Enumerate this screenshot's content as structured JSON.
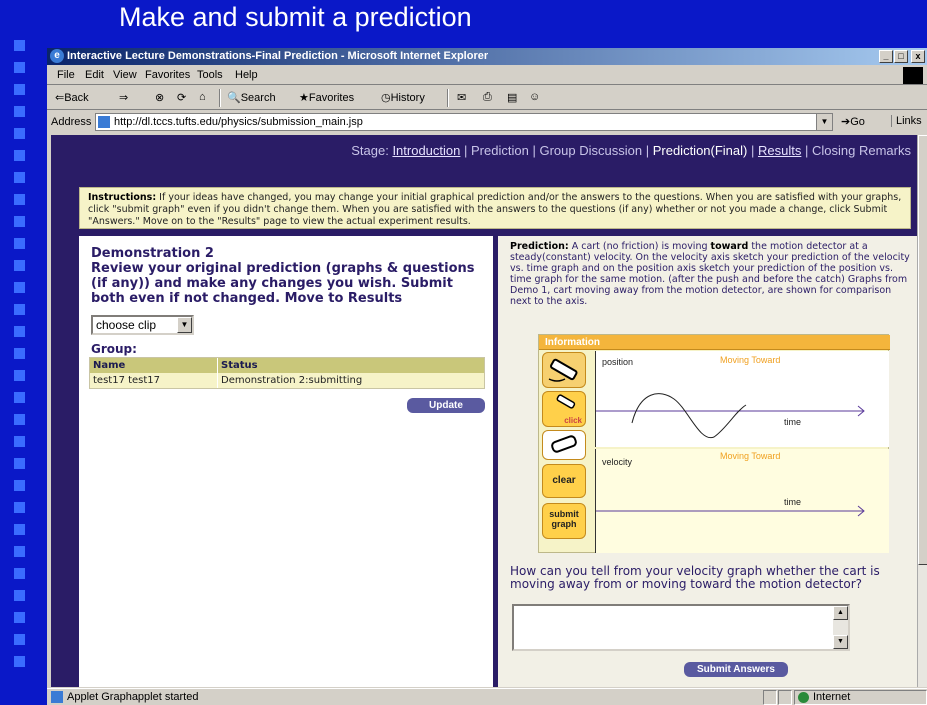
{
  "slide": {
    "title": "Make and submit a prediction"
  },
  "window": {
    "title": "Interactive Lecture Demonstrations-Final Prediction - Microsoft Internet Explorer",
    "controls": [
      "_",
      "□",
      "x"
    ]
  },
  "menubar": [
    "File",
    "Edit",
    "View",
    "Favorites",
    "Tools",
    "Help"
  ],
  "toolbar": {
    "back": "⇐Back",
    "forward": "⇒",
    "search": "Search",
    "favorites": "Favorites",
    "history": "History"
  },
  "address": {
    "label": "Address",
    "url": "http://dl.tccs.tufts.edu/physics/submission_main.jsp",
    "go": "Go",
    "links": "Links"
  },
  "stages": {
    "label": "Stage:",
    "items": [
      "Introduction",
      "Prediction",
      "Group Discussion",
      "Prediction(Final)",
      "Results",
      "Closing Remarks"
    ],
    "sep": "|"
  },
  "instructions": {
    "label": "Instructions:",
    "text": "If your ideas have changed, you may change your initial graphical prediction and/or the answers to the questions. When you are satisfied with your graphs, click \"submit graph\" even if you didn't change them. When you are satisfied with the answers to the questions (if any) whether or not you made a change, click Submit \"Answers.\" Move on to the \"Results\" page to view the actual experiment results."
  },
  "left": {
    "demo_title": "Demonstration 2",
    "demo_body": "Review your original prediction (graphs & questions (if any)) and make any changes you wish. Submit both even if not changed. Move to Results",
    "clip_select": "choose clip",
    "group_label": "Group:",
    "table": {
      "headers": [
        "Name",
        "Status"
      ],
      "rows": [
        [
          "test17 test17",
          "Demonstration 2:submitting"
        ]
      ]
    },
    "update_button": "Update"
  },
  "right": {
    "prediction_label": "Prediction:",
    "prediction_a": "A cart (no friction) is moving",
    "prediction_bold": "toward",
    "prediction_b": "the motion detector at a steady(constant) velocity. On the velocity axis sketch your prediction of the velocity vs. time graph and on the position axis sketch your prediction of the position vs. time graph for the same motion. (after the push and before the catch) Graphs from Demo 1, cart moving away from the motion detector, are shown for comparison next to the axis.",
    "applet": {
      "info_label": "Information",
      "tools": {
        "pencil": "",
        "click": "click",
        "eraser": "",
        "clear": "clear",
        "submit": "submit graph"
      },
      "position_graph": {
        "label": "position",
        "tag": "Moving Toward",
        "axis": "time"
      },
      "velocity_graph": {
        "label": "velocity",
        "tag": "Moving Toward",
        "axis": "time"
      }
    },
    "question": "How can you tell from your velocity graph whether the cart is moving away from or moving toward the motion detector?",
    "answer_value": "",
    "submit_answers": "Submit Answers"
  },
  "status": {
    "text": "Applet Graphapplet started",
    "zone": "Internet"
  },
  "colors": {
    "slide_bg": "#0a18c8",
    "page_bg": "#2a1c66",
    "instruction_bg": "#f6f3c8",
    "info_bar": "#f4b53c",
    "button": "#5a5aa0"
  }
}
